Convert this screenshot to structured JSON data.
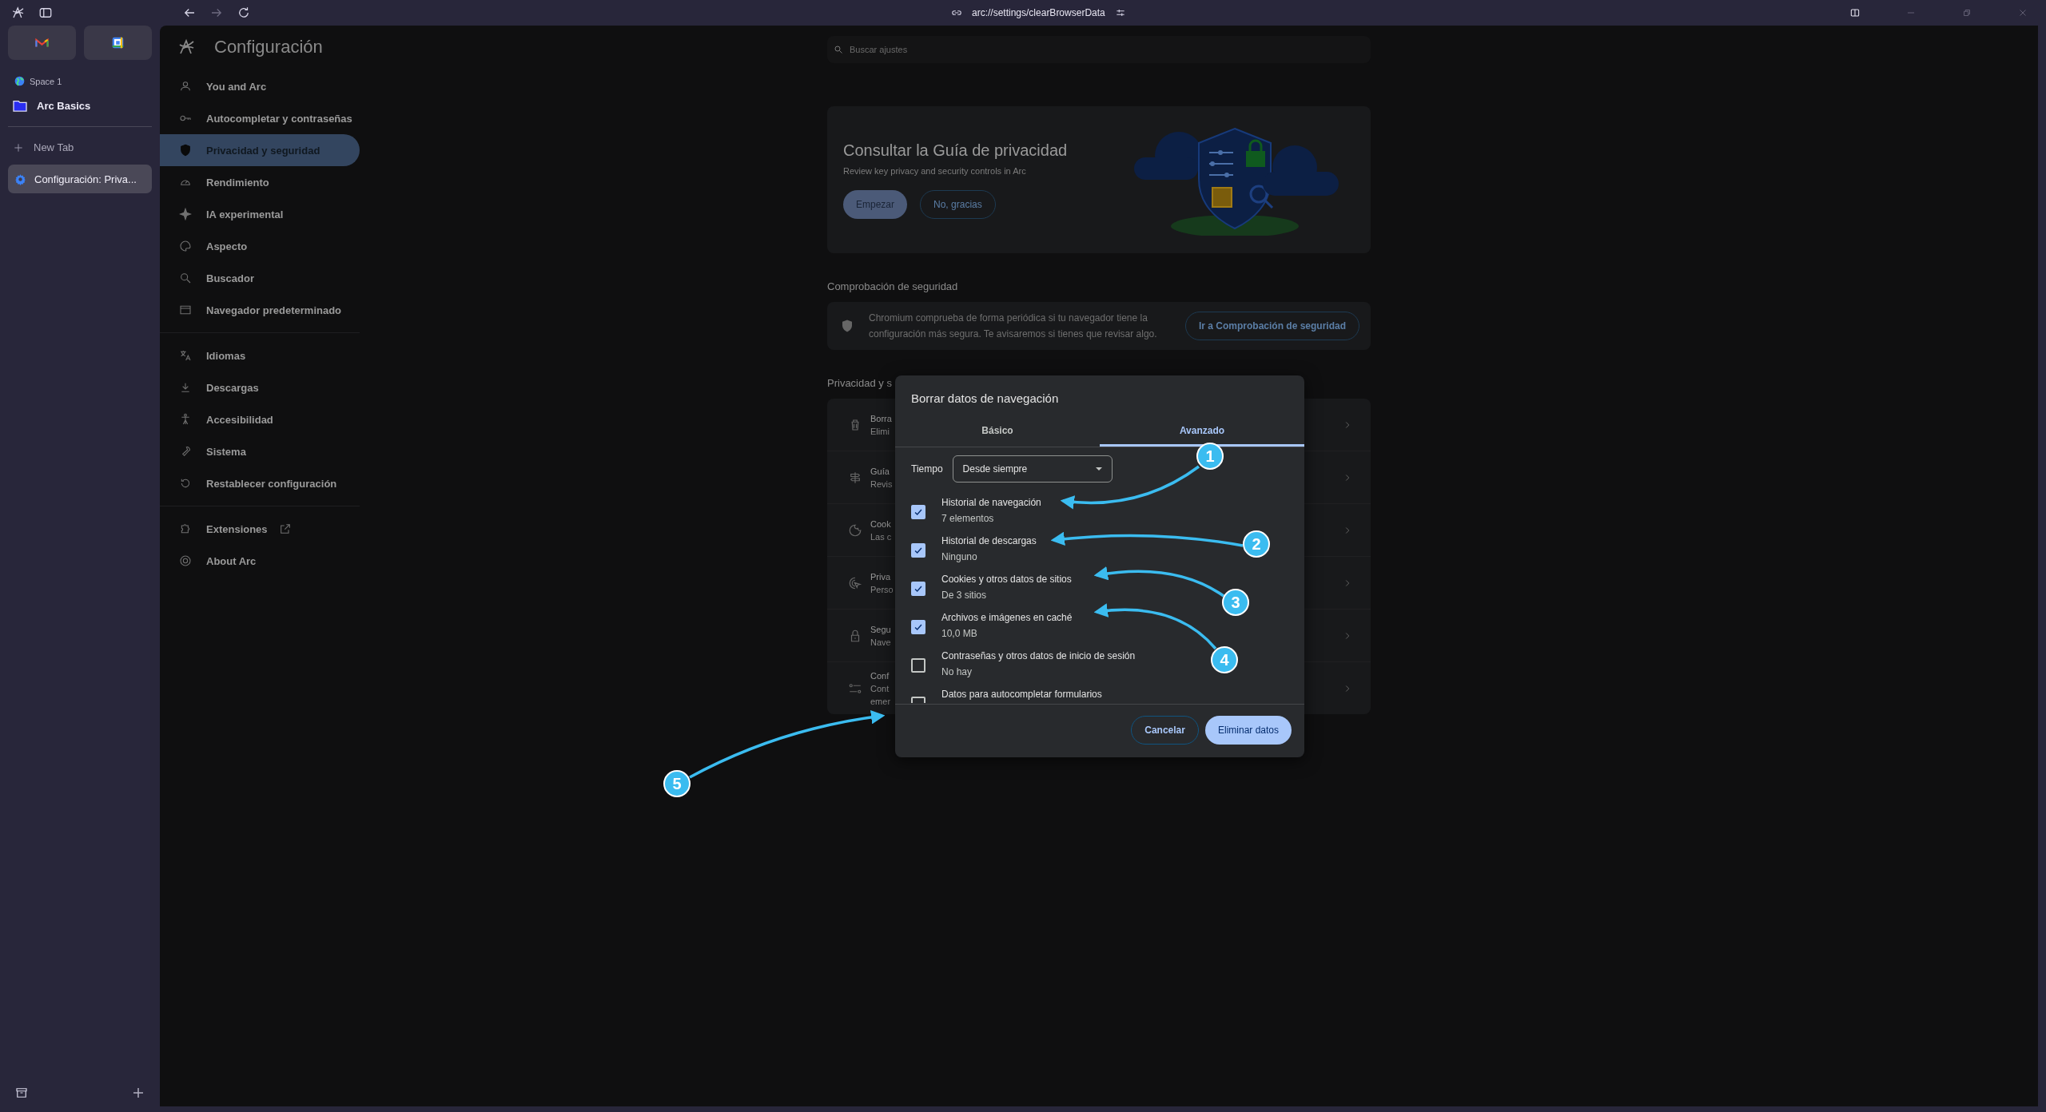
{
  "browser": {
    "url": "arc://settings/clearBrowserData"
  },
  "sidebar": {
    "space": "Space 1",
    "folder": "Arc Basics",
    "new_tab": "New Tab",
    "tabs": [
      {
        "title": "Configuración: Priva...",
        "selected": true
      }
    ]
  },
  "settings": {
    "title": "Configuración",
    "search_placeholder": "Buscar ajustes",
    "nav_groups": [
      [
        {
          "label": "You and Arc",
          "selected": false
        },
        {
          "label": "Autocompletar y contraseñas",
          "selected": false
        },
        {
          "label": "Privacidad y seguridad",
          "selected": true
        },
        {
          "label": "Rendimiento",
          "selected": false
        },
        {
          "label": "IA experimental",
          "selected": false
        },
        {
          "label": "Aspecto",
          "selected": false
        },
        {
          "label": "Buscador",
          "selected": false
        },
        {
          "label": "Navegador predeterminado",
          "selected": false
        }
      ],
      [
        {
          "label": "Idiomas",
          "selected": false
        },
        {
          "label": "Descargas",
          "selected": false
        },
        {
          "label": "Accesibilidad",
          "selected": false
        },
        {
          "label": "Sistema",
          "selected": false
        },
        {
          "label": "Restablecer configuración",
          "selected": false
        }
      ],
      [
        {
          "label": "Extensiones",
          "selected": false,
          "external": true
        },
        {
          "label": "About Arc",
          "selected": false
        }
      ]
    ]
  },
  "privacy_guide": {
    "title": "Consultar la Guía de privacidad",
    "subtitle": "Review key privacy and security controls in Arc",
    "primary_button": "Empezar",
    "secondary_button": "No, gracias"
  },
  "safety_check": {
    "heading": "Comprobación de seguridad",
    "text": "Chromium comprueba de forma periódica si tu navegador tiene la configuración más segura. Te avisaremos si tienes que revisar algo.",
    "button": "Ir a Comprobación de seguridad"
  },
  "privacy_section": {
    "heading": "Privacidad y s",
    "rows": [
      {
        "lines": [
          "Borra",
          "Elimi"
        ]
      },
      {
        "lines": [
          "Guía",
          "Revis"
        ]
      },
      {
        "lines": [
          "Cook",
          "Las c"
        ]
      },
      {
        "lines": [
          "Priva",
          "Perso"
        ]
      },
      {
        "lines": [
          "Segu",
          "Nave"
        ]
      },
      {
        "lines": [
          "Conf",
          "Cont",
          "emer"
        ]
      }
    ]
  },
  "dialog": {
    "title": "Borrar datos de navegación",
    "tabs": [
      {
        "label": "Básico",
        "selected": false
      },
      {
        "label": "Avanzado",
        "selected": true
      }
    ],
    "time_label": "Tiempo",
    "time_value": "Desde siempre",
    "items": [
      {
        "label": "Historial de navegación",
        "detail": "7 elementos",
        "checked": true
      },
      {
        "label": "Historial de descargas",
        "detail": "Ninguno",
        "checked": true
      },
      {
        "label": "Cookies y otros datos de sitios",
        "detail": "De 3 sitios",
        "checked": true
      },
      {
        "label": "Archivos e imágenes en caché",
        "detail": "10,0 MB",
        "checked": true
      },
      {
        "label": "Contraseñas y otros datos de inicio de sesión",
        "detail": "No hay",
        "checked": false
      },
      {
        "label": "Datos para autocompletar formularios",
        "checked": false
      }
    ],
    "cancel_button": "Cancelar",
    "confirm_button": "Eliminar datos"
  },
  "annotations": [
    {
      "label": "1"
    },
    {
      "label": "2"
    },
    {
      "label": "3"
    },
    {
      "label": "4"
    },
    {
      "label": "5"
    }
  ]
}
